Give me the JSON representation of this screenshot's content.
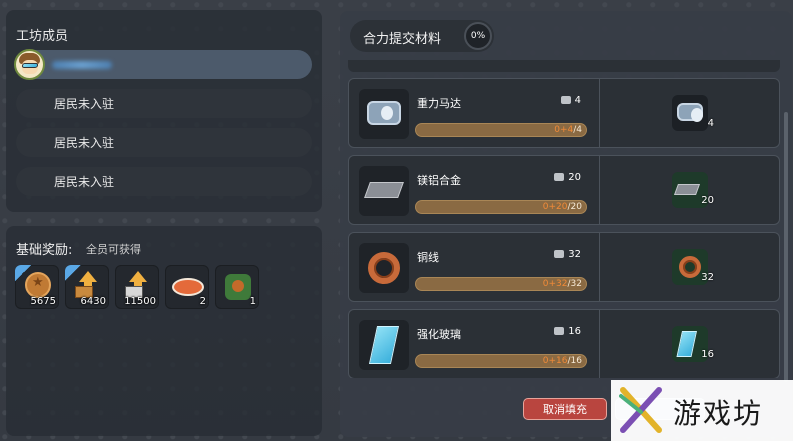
{
  "left_panel": {
    "members_title": "工坊成员",
    "members": [
      {
        "label": ""
      },
      {
        "label": "居民未入驻"
      },
      {
        "label": "居民未入驻"
      },
      {
        "label": "居民未入驻"
      }
    ],
    "reward_title": "基础奖励:",
    "reward_subtitle": "全员可获得",
    "rewards": [
      {
        "icon": "coin-icon",
        "count": "5675"
      },
      {
        "icon": "upgrade-box-icon",
        "count": "6430"
      },
      {
        "icon": "upgrade-crate-icon",
        "count": "11500"
      },
      {
        "icon": "grilled-fish-icon",
        "count": "2"
      },
      {
        "icon": "plant-icon",
        "count": "1"
      }
    ]
  },
  "right_panel": {
    "title": "合力提交材料",
    "progress_percent": "0%",
    "materials": [
      {
        "name": "重力马达",
        "stock": "4",
        "current": "0",
        "required": "4",
        "icon": "motor-icon",
        "slot_count": "4",
        "progress": 0
      },
      {
        "name": "镁铝合金",
        "stock": "20",
        "current": "0",
        "required": "20",
        "icon": "ingot-icon",
        "slot_count": "20",
        "progress": 0
      },
      {
        "name": "铜线",
        "stock": "32",
        "current": "0",
        "required": "32",
        "icon": "copper-coil-icon",
        "slot_count": "32",
        "progress": 0
      },
      {
        "name": "强化玻璃",
        "stock": "16",
        "current": "0",
        "required": "16",
        "icon": "glass-pane-icon",
        "slot_count": "16",
        "progress": 0
      }
    ],
    "cancel_button": "取消填充"
  },
  "watermark": {
    "text": "游戏坊"
  },
  "colors": {
    "accent_blue": "#5aa8e6",
    "cancel_red": "#b9453f",
    "progress_brown": "#8a6a43",
    "progress_orange": "#f08a38"
  }
}
